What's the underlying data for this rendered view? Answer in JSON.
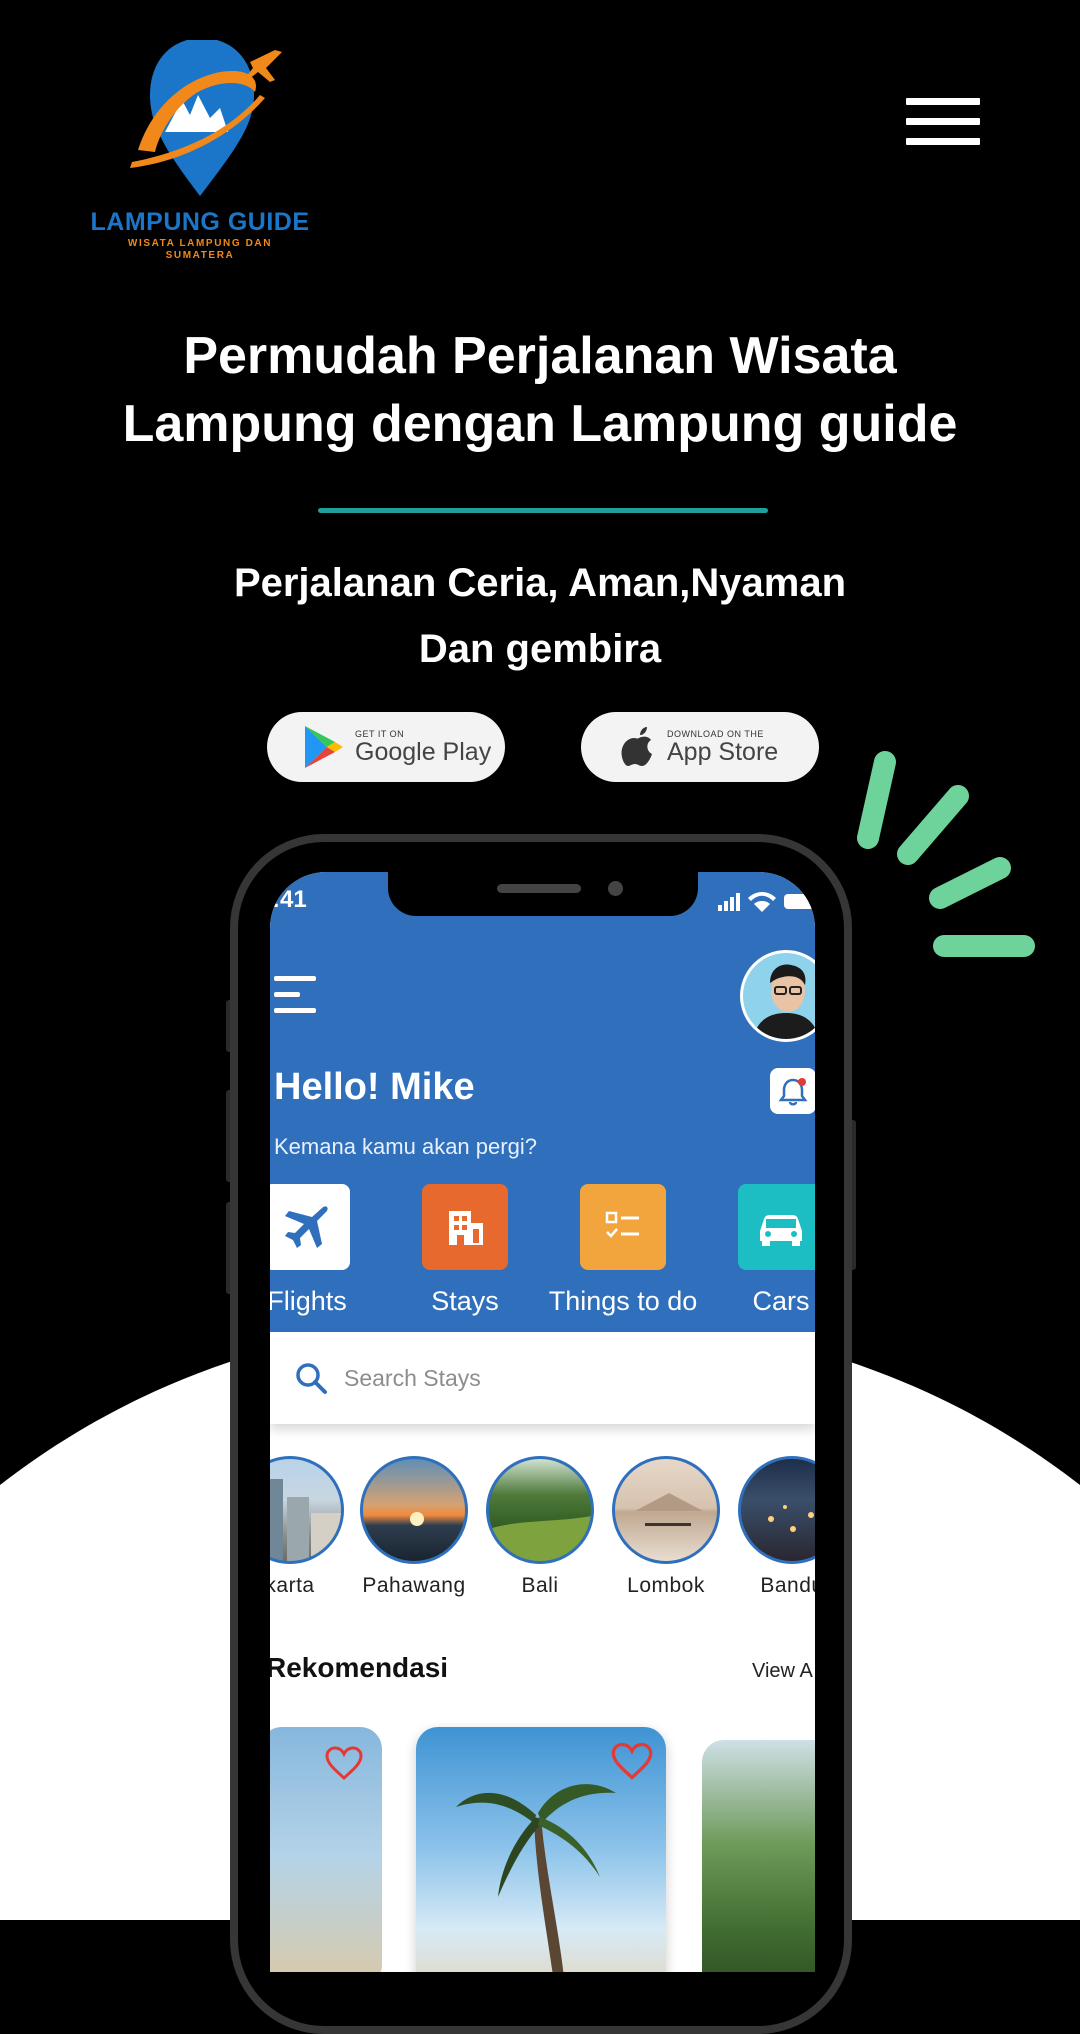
{
  "brand": {
    "name": "LAMPUNG GUIDE",
    "tagline_line1": "WISATA LAMPUNG DAN",
    "tagline_line2": "SUMATERA"
  },
  "hero": {
    "headline_line1": "Permudah Perjalanan Wisata",
    "headline_line2": "Lampung dengan Lampung guide",
    "tagline_line1": "Perjalanan Ceria, Aman,Nyaman",
    "tagline_line2": "Dan gembira"
  },
  "stores": {
    "google_small": "GET IT ON",
    "google_big": "Google Play",
    "apple_small": "DOWNLOAD ON THE",
    "apple_big": "App Store"
  },
  "app": {
    "status_time": ":41",
    "greeting": "Hello! Mike",
    "question": "Kemana kamu akan pergi?",
    "categories": [
      {
        "label": "Flights",
        "icon": "airplane-icon",
        "color": "#ffffff"
      },
      {
        "label": "Stays",
        "icon": "building-icon",
        "color": "#e8692d"
      },
      {
        "label": "Things to do",
        "icon": "checklist-icon",
        "color": "#f2a53c"
      },
      {
        "label": "Cars",
        "icon": "car-icon",
        "color": "#1dbdc4"
      }
    ],
    "search_placeholder": "Search Stays",
    "destinations": [
      "karta",
      "Pahawang",
      "Bali",
      "Lombok",
      "Bandu"
    ],
    "section_title": "Rekomendasi",
    "view_all": "View A"
  },
  "colors": {
    "background": "#000000",
    "app_blue": "#2f6fbc",
    "divider": "#1f9d9f",
    "accent_green": "#6dd39a",
    "logo_orange": "#f0891a",
    "logo_blue": "#1b76c9"
  }
}
